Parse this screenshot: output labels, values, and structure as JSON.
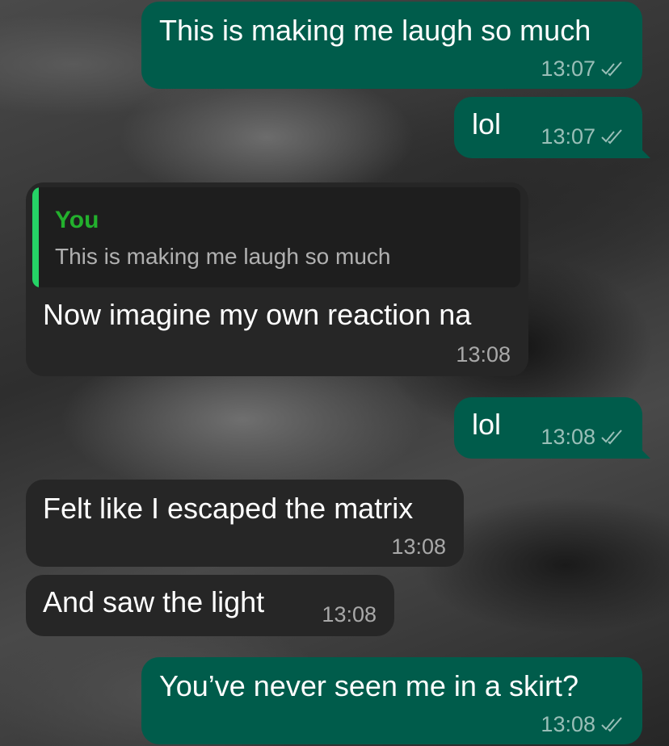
{
  "messages": [
    {
      "id": "m1",
      "direction": "outgoing",
      "text": "This is making me laugh so much",
      "time": "13:07",
      "status": "read"
    },
    {
      "id": "m2",
      "direction": "outgoing",
      "text": "lol",
      "time": "13:07",
      "status": "read"
    },
    {
      "id": "m3",
      "direction": "incoming",
      "reply_to": {
        "author": "You",
        "text": "This is making me laugh so much"
      },
      "text": "Now imagine my own reaction na",
      "time": "13:08"
    },
    {
      "id": "m4",
      "direction": "outgoing",
      "text": "lol",
      "time": "13:08",
      "status": "read"
    },
    {
      "id": "m5",
      "direction": "incoming",
      "text": "Felt like I escaped the matrix",
      "time": "13:08"
    },
    {
      "id": "m6",
      "direction": "incoming",
      "text": "And saw the light",
      "time": "13:08"
    },
    {
      "id": "m7",
      "direction": "outgoing",
      "text": "You’ve never seen me in a skirt?",
      "time": "13:08",
      "status": "read"
    }
  ],
  "icons": {
    "read_receipt": "double-check-icon"
  },
  "colors": {
    "outgoing_bubble": "#005c4b",
    "incoming_bubble": "#262626",
    "quote_accent": "#25d366",
    "quote_author": "#23b02d"
  }
}
